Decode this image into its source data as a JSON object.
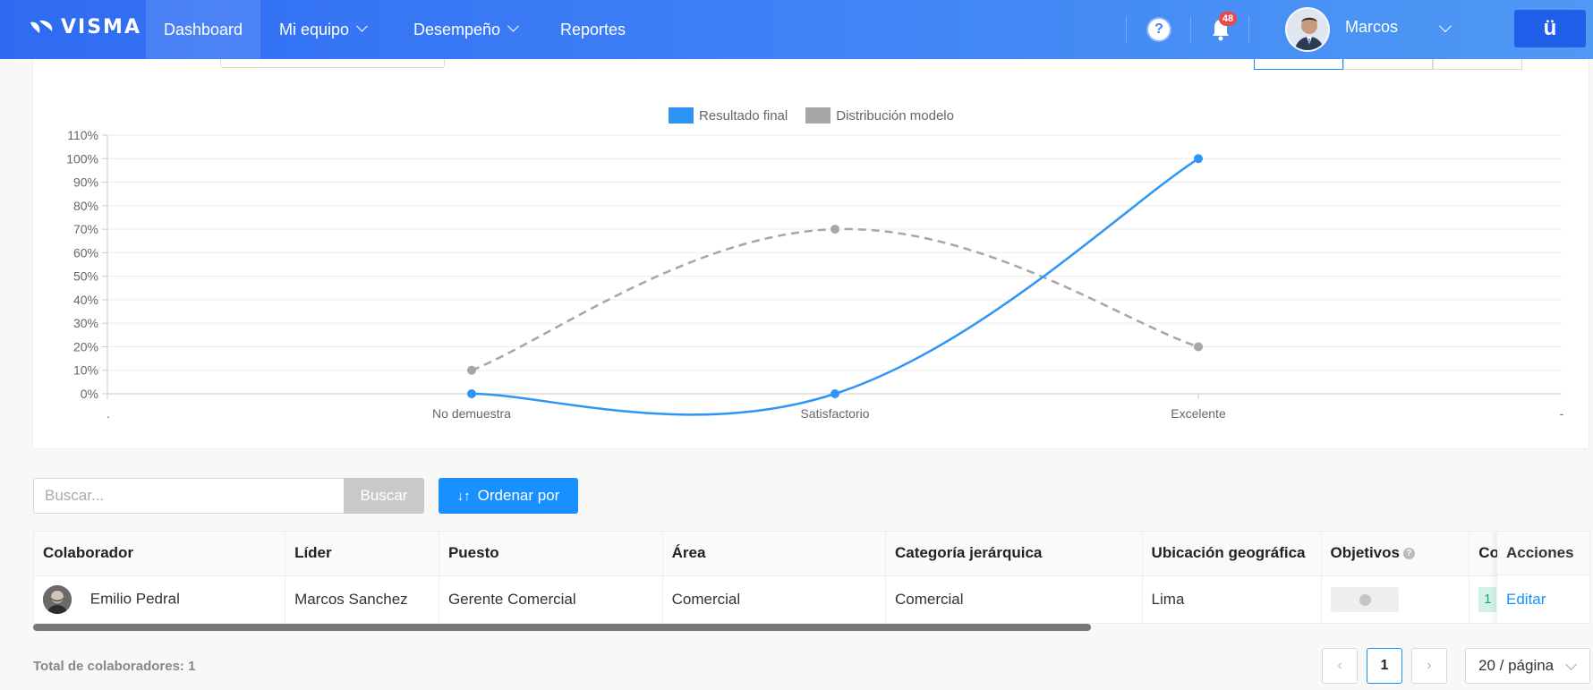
{
  "brand": {
    "logo_text": "VISMA"
  },
  "nav": {
    "items": [
      {
        "label": "Dashboard"
      },
      {
        "label": "Mi equipo"
      },
      {
        "label": "Desempeño"
      },
      {
        "label": "Reportes"
      }
    ],
    "help_label": "?",
    "notifications_count": "48",
    "user_name": "Marcos",
    "app_button_label": "ü"
  },
  "chart_data": {
    "type": "line",
    "categories": [
      "No demuestra",
      "Satisfactorio",
      "Excelente"
    ],
    "x_edge_labels": [
      ".",
      "-"
    ],
    "y_ticks": [
      "0%",
      "10%",
      "20%",
      "30%",
      "40%",
      "50%",
      "60%",
      "70%",
      "80%",
      "90%",
      "100%",
      "110%"
    ],
    "ylim": [
      0,
      110
    ],
    "grid": true,
    "legend_position": "top-center",
    "series": [
      {
        "name": "Resultado final",
        "values": [
          0,
          0,
          100
        ],
        "color": "#2f95f5",
        "dashed": false
      },
      {
        "name": "Distribución modelo",
        "values": [
          10,
          70,
          20
        ],
        "color": "#a6a6a6",
        "dashed": true
      }
    ]
  },
  "search": {
    "placeholder": "Buscar...",
    "button_label": "Buscar"
  },
  "sort": {
    "label": "Ordenar por"
  },
  "table": {
    "columns": [
      "Colaborador",
      "Líder",
      "Puesto",
      "Área",
      "Categoría jerárquica",
      "Ubicación geográfica",
      "Objetivos",
      "Co",
      "Acciones"
    ],
    "rows": [
      {
        "colaborador": "Emilio Pedral",
        "lider": "Marcos Sanchez",
        "puesto": "Gerente Comercial",
        "area": "Comercial",
        "categoria": "Comercial",
        "ubicacion": "Lima",
        "co_value": "1",
        "accion": "Editar"
      }
    ]
  },
  "footer": {
    "total_label": "Total de colaboradores: 1",
    "current_page": "1",
    "page_size": "20 / página",
    "prev_icon": "‹",
    "next_icon": "›"
  }
}
